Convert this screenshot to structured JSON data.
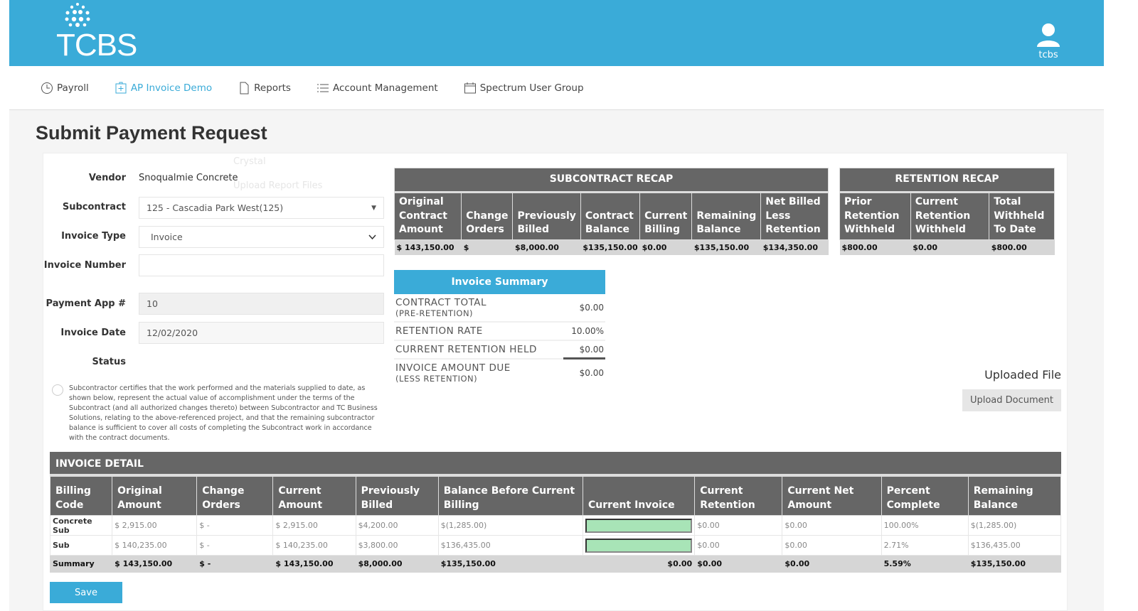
{
  "app": {
    "logo_text": "TCBS",
    "user": "tcbs",
    "brand_color": "#3aabd8"
  },
  "nav": [
    {
      "label": "Payroll",
      "icon": "clock-icon"
    },
    {
      "label": "AP Invoice Demo",
      "icon": "invoice-add-icon",
      "active": true
    },
    {
      "label": "Reports",
      "icon": "document-icon"
    },
    {
      "label": "Account Management",
      "icon": "list-icon"
    },
    {
      "label": "Spectrum User Group",
      "icon": "calendar-icon"
    }
  ],
  "ghost_menu": [
    "Crystal",
    "Upload Report Files"
  ],
  "page_title": "Submit Payment Request",
  "form": {
    "vendor_label": "Vendor",
    "vendor": "Snoqualmie Concrete",
    "subcontract_label": "Subcontract",
    "subcontract": "125 - Cascadia Park West(125)",
    "invoice_type_label": "Invoice Type",
    "invoice_type": "Invoice",
    "invoice_number_label": "Invoice Number",
    "invoice_number": "",
    "payment_app_label": "Payment App #",
    "payment_app": "10",
    "invoice_date_label": "Invoice Date",
    "invoice_date": "12/02/2020",
    "status_label": "Status",
    "certification": "Subcontractor certifies that the work performed and the materials supplied to date, as shown below, represent the actual value of accomplishment under the terms of the Subcontract (and all authorized changes thereto) between Subcontractor and TC Business Solutions, relating to the above-referenced project, and that the remaining subcontractor balance is sufficient to cover all costs of completing the Subcontract work in accordance with the contract documents."
  },
  "subcontract_recap": {
    "title": "SUBCONTRACT RECAP",
    "headers": [
      "Original Contract Amount",
      "Change Orders",
      "Previously Billed",
      "Contract Balance",
      "Current Billing",
      "Remaining Balance",
      "Net Billed Less Retention"
    ],
    "values": [
      "$ 143,150.00",
      "$",
      "$8,000.00",
      "$135,150.00",
      "$0.00",
      "$135,150.00",
      "$134,350.00"
    ]
  },
  "retention_recap": {
    "title": "RETENTION RECAP",
    "headers": [
      "Prior Retention Withheld",
      "Current Retention Withheld",
      "Total Withheld To Date"
    ],
    "values": [
      "$800.00",
      "$0.00",
      "$800.00"
    ]
  },
  "invoice_summary": {
    "title": "Invoice Summary",
    "contract_total": "CONTRACT TOTAL",
    "contract_total_sub": "(PRE-RETENTION)",
    "contract_total_value": "$0.00",
    "retention_rate": "RETENTION RATE",
    "retention_rate_value": "10.00%",
    "current_retention": "CURRENT RETENTION HELD",
    "current_retention_value": "$0.00",
    "amount_due": "INVOICE AMOUNT DUE",
    "amount_due_sub": "(LESS RETENTION)",
    "amount_due_value": "$0.00"
  },
  "upload": {
    "label": "Uploaded File",
    "button": "Upload Document"
  },
  "invoice_detail": {
    "title": "INVOICE DETAIL",
    "headers": [
      "Billing Code",
      "Original Amount",
      "Change Orders",
      "Current Amount",
      "Previously Billed",
      "Balance Before Current Billing",
      "Current Invoice",
      "Current Retention",
      "Current Net Amount",
      "Percent Complete",
      "Remaining Balance"
    ],
    "rows": [
      [
        "Concrete Sub",
        "$ 2,915.00",
        "$ -",
        "$ 2,915.00",
        "$4,200.00",
        "$(1,285.00)",
        "",
        "$0.00",
        "$0.00",
        "100.00%",
        "$(1,285.00)"
      ],
      [
        "Sub",
        "$ 140,235.00",
        "$ -",
        "$ 140,235.00",
        "$3,800.00",
        "$136,435.00",
        "",
        "$0.00",
        "$0.00",
        "2.71%",
        "$136,435.00"
      ]
    ],
    "summary": [
      "Summary",
      "$ 143,150.00",
      "$ -",
      "$ 143,150.00",
      "$8,000.00",
      "$135,150.00",
      "$0.00",
      "$0.00",
      "$0.00",
      "5.59%",
      "$135,150.00"
    ]
  },
  "save_label": "Save"
}
